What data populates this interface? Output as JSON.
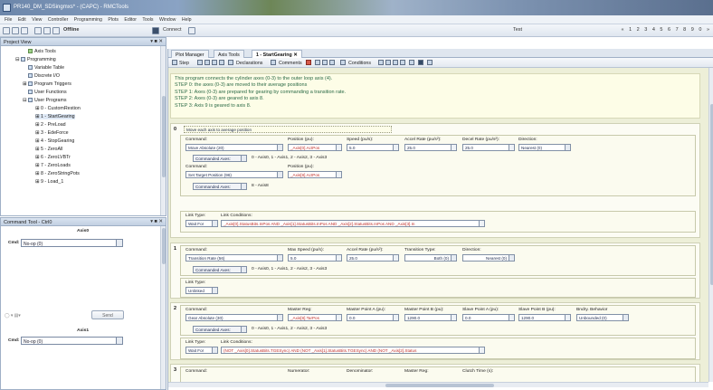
{
  "window": {
    "title": "PR140_DM_SDSingmxs* - (CAPC) - RMCTools"
  },
  "menu": [
    "File",
    "Edit",
    "View",
    "Controller",
    "Programming",
    "Plots",
    "Editor",
    "Tools",
    "Window",
    "Help"
  ],
  "toolbar": {
    "offline": "Offline",
    "connect": "Connect",
    "combo": "Test",
    "pager": "« 1 2 3 4 5 6 7 8 9 0 »"
  },
  "project_view": {
    "title": "Project View",
    "controls": "▾ ■ ✕",
    "items": [
      {
        "label": "Axis Tools",
        "indent": 3
      },
      {
        "label": "Programming",
        "indent": 1
      },
      {
        "label": "Variable Table",
        "indent": 2
      },
      {
        "label": "Discrete I/O",
        "indent": 2
      },
      {
        "label": "Program Triggers",
        "indent": 2
      },
      {
        "label": "User Functions",
        "indent": 2
      },
      {
        "label": "User Programs",
        "indent": 2
      },
      {
        "label": "0 - CustomRestion",
        "indent": 3
      },
      {
        "label": "1 - StartGearing",
        "indent": 3
      },
      {
        "label": "2 - PreLoad",
        "indent": 3
      },
      {
        "label": "3 - EdeForce",
        "indent": 3
      },
      {
        "label": "4 - StopGearing",
        "indent": 3
      },
      {
        "label": "5 - ZeroAll",
        "indent": 3
      },
      {
        "label": "6 - ZeroLVBTr",
        "indent": 3
      },
      {
        "label": "7 - ZeroLoads",
        "indent": 3
      },
      {
        "label": "8 - ZeroStringPots",
        "indent": 3
      },
      {
        "label": "9 - Load_1",
        "indent": 3
      }
    ]
  },
  "command_tool": {
    "title": "Command Tool - Ctrl0",
    "controls": "▾ ■ ✕",
    "axis0_label": "Axis0",
    "cmd_label": "Cmd:",
    "cmd0_value": "No-op (0)",
    "send_label": "Send",
    "axis1_label": "Axis1",
    "cmd1_value": "No-op (0)"
  },
  "editor": {
    "tabs": [
      "Plot Manager",
      "Axis Tools",
      "1 - StartGearing"
    ],
    "toolbar": {
      "step": "Step",
      "declarations": "Declarations",
      "comments": "Comments",
      "conditions": "Conditions"
    },
    "description": [
      "This program connects the cylinder axes (0-3) to the outer loop axis (4).",
      "STEP 0: the axes (0-3) are moved to their average positions",
      "STEP 1: Axes (0-3) are prepared for gearing by commanding a transition rate.",
      "STEP 2: Axes (0-3) are geared to axis 8.",
      "STEP 3: Axis 9 is geared to axis 8."
    ],
    "steps": [
      {
        "num": "0",
        "comment": "Move each axis to average position",
        "labels": {
          "command": "Command:",
          "position": "Position (pu):",
          "speed": "Speed (pu/s):",
          "accel": "Accel Rate (pu/s²):",
          "decel": "Decel Rate (pu/s²):",
          "direction": "Direction:",
          "command2": "Command:",
          "position2": "Position (pu):",
          "link_type": "Link Type:",
          "link_cond": "Link Conditions:"
        },
        "cmd": "Move Absolute (20)",
        "position": "_Axis[0].ActPos",
        "speed": "5.0",
        "accel": "25.0",
        "decel": "25.0",
        "direction": "Nearest (0)",
        "axes1_label": "Commanded Axes:",
        "axes1_value": "0 - Axis0, 1 - Axis1, 2 - Axis2, 3 - Axis3",
        "cmd2": "Set Target Position (96)",
        "position2": "_Axis[8].ActPos",
        "axes2_label": "Commanded Axes:",
        "axes2_value": "8 - Axis8",
        "link_type": "Wait For",
        "link_cond": "_Axis[0].StatusBits.InPos AND _Axis[1].StatusBits.InPos AND _Axis[2].StatusBits.InPos AND _Axis[3].In"
      },
      {
        "num": "1",
        "labels": {
          "command": "Command:",
          "max_speed": "Max Speed (pu/s):",
          "accel": "Accel Rate (pu/s²):",
          "transition": "Transition Type:",
          "direction": "Direction:",
          "link_type": "Link Type:"
        },
        "cmd": "Transition Rate (56)",
        "max_speed": "5.0",
        "accel": "25.0",
        "transition": "Both (0)",
        "direction": "Nearest (0)",
        "axes_label": "Commanded Axes:",
        "axes_value": "0 - Axis0, 1 - Axis1, 2 - Axis2, 3 - Axis3",
        "link_type": "Unlinked"
      },
      {
        "num": "2",
        "labels": {
          "command": "Command:",
          "master_reg": "Master Reg:",
          "mp_a": "Master Point A (pu):",
          "mp_b": "Master Point B (pu):",
          "sp_a": "Slave Point A (pu):",
          "sp_b": "Slave Point B (pu):",
          "behavior": "Bndry. Behavior",
          "link_type": "Link Type:",
          "link_cond": "Link Conditions:"
        },
        "cmd": "Gear Absolute (30)",
        "master_reg": "_Axis[8].TarPos",
        "mp_a": "0.0",
        "mp_b": "1290.0",
        "sp_a": "0.0",
        "sp_b": "1290.0",
        "behavior": "Unbounded (0)",
        "axes_label": "Commanded Axes:",
        "axes_value": "0 - Axis0, 1 - Axis1, 2 - Axis2, 3 - Axis3",
        "link_type": "Wait For",
        "link_cond": "(NOT _Axis[0].StatusBits.TGESync) AND (NOT _Axis[1].StatusBits.TGESync) AND (NOT _Axis[2].Status"
      },
      {
        "num": "3",
        "labels": {
          "command": "Command:",
          "numerator": "Numerator:",
          "denominator": "Denominator:",
          "master_reg": "Master Reg:",
          "clutch": "Clutch Time (s):"
        }
      }
    ]
  }
}
